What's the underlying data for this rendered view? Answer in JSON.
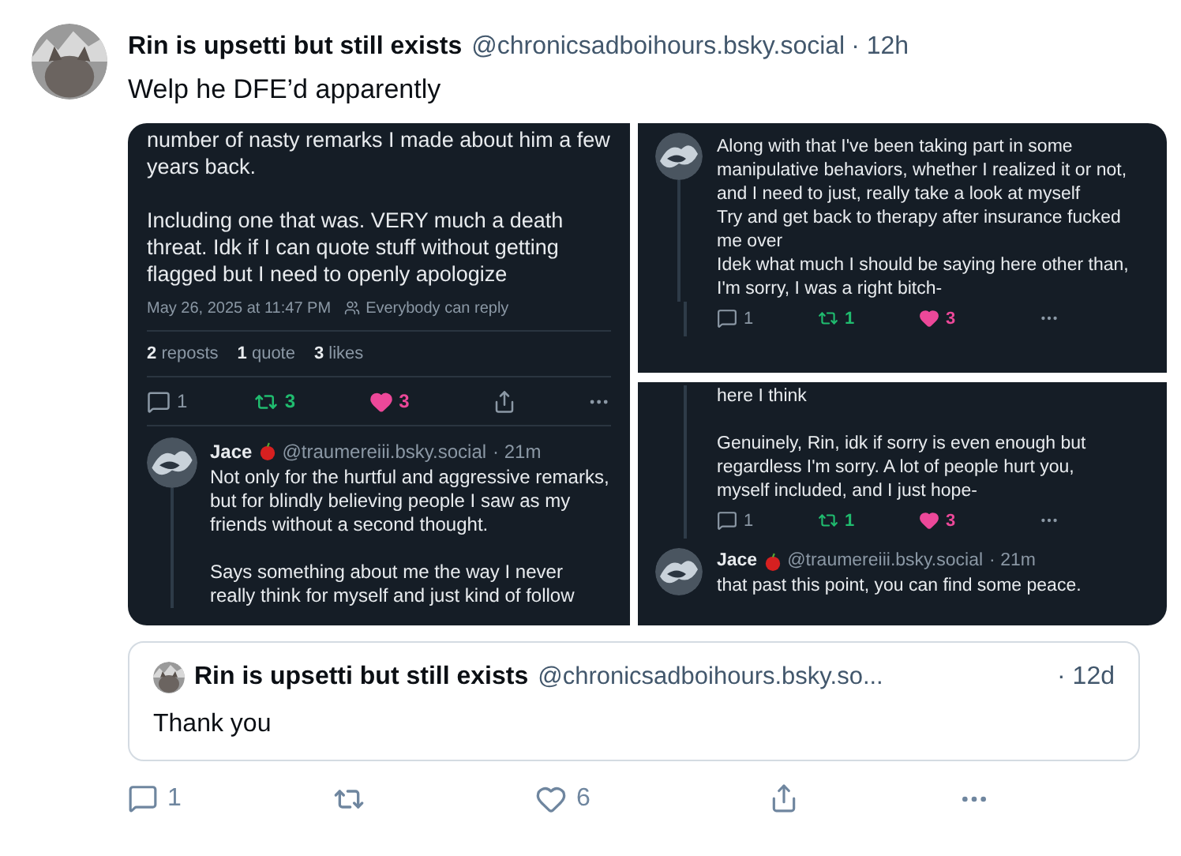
{
  "post": {
    "author": "Rin is upsetti but still exists",
    "handle": "@chronicsadboihours.bsky.social",
    "time": "· 12h",
    "text": "Welp he DFE’d apparently"
  },
  "screenshots": [
    {
      "blocks": [
        {
          "kind": "text",
          "text": "number of nasty remarks I made about him a few years back.\n\nIncluding one that was. VERY much a death threat. Idk if I can quote stuff without getting flagged but I need to openly apologize"
        },
        {
          "kind": "meta",
          "date": "May 26, 2025 at 11:47 PM",
          "audience": "Everybody can reply"
        },
        {
          "kind": "stats",
          "items": [
            {
              "count": "2",
              "label": "reposts"
            },
            {
              "count": "1",
              "label": "quote"
            },
            {
              "count": "3",
              "label": "likes"
            }
          ]
        },
        {
          "kind": "actions",
          "replies": "1",
          "reposts": "3",
          "likes": "3",
          "reposted": true,
          "liked": true,
          "share": true
        },
        {
          "kind": "reply",
          "author": "Jace",
          "handle": "@traumereiii.bsky.social",
          "time": "· 21m",
          "text": "Not only for the hurtful and aggressive remarks, but for blindly believing people I saw as my friends without a second thought.\n\nSays something about me the way I never really think for myself and just kind of follow"
        }
      ]
    },
    {
      "blocks": [
        {
          "kind": "continued",
          "text": "Along with that I've been taking part in some manipulative behaviors, whether I realized it or not, and I need to just, really take a look at myself\nTry and get back to therapy after insurance fucked me over\nIdek what much I should be saying here other than, I'm sorry, I was a right bitch-"
        },
        {
          "kind": "actions",
          "replies": "1",
          "reposts": "1",
          "likes": "3",
          "reposted": true,
          "liked": true,
          "share": false
        }
      ]
    },
    {
      "blocks": [
        {
          "kind": "text_indented",
          "text": "here I think\n\nGenuinely, Rin, idk if sorry is even enough but regardless I'm sorry. A lot of people hurt you, myself included, and I just hope-"
        },
        {
          "kind": "actions",
          "replies": "1",
          "reposts": "1",
          "likes": "3",
          "reposted": true,
          "liked": true,
          "share": false
        },
        {
          "kind": "reply",
          "author": "Jace",
          "handle": "@traumereiii.bsky.social",
          "time": "· 21m",
          "text": "that past this point, you can find some peace."
        }
      ]
    }
  ],
  "quote": {
    "author": "Rin is upsetti but still exists",
    "handle": "@chronicsadboihours.bsky.so...",
    "time": "· 12d",
    "text": "Thank you"
  },
  "actions": {
    "replies": "1",
    "likes": "6",
    "liked": false
  }
}
